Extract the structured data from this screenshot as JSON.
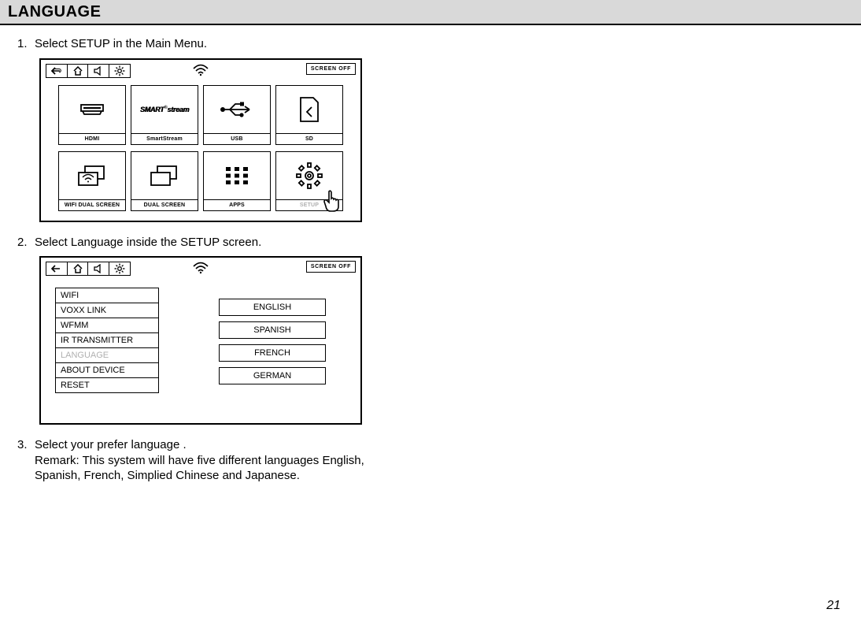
{
  "title": "LANGUAGE",
  "steps": {
    "s1_num": "1.",
    "s1_text": "Select SETUP in the Main Menu.",
    "s2_num": "2.",
    "s2_text": "Select Language inside the SETUP screen.",
    "s3_num": "3.",
    "s3_text": "Select your prefer language .",
    "s3_remark": "Remark: This system will have five different languages English, Spanish, French, Simplied Chinese and Japanese."
  },
  "screen_off": "SCREEN OFF",
  "tiles": {
    "hdmi": "HDMI",
    "smartstream": "SmartStream",
    "smartstream_logo_a": "SMART",
    "smartstream_logo_b": "stream",
    "usb": "USB",
    "sd": "SD",
    "wifi_dual": "WIFI DUAL SCREEN",
    "dual": "DUAL SCREEN",
    "apps": "APPS",
    "setup": "SETUP"
  },
  "setup_sidebar": [
    "WIFI",
    "VOXX LINK",
    "WFMM",
    "IR TRANSMITTER",
    "LANGUAGE",
    "ABOUT DEVICE",
    "RESET"
  ],
  "lang_options": [
    "ENGLISH",
    "SPANISH",
    "FRENCH",
    "GERMAN"
  ],
  "icons": {
    "back": "back-icon",
    "home": "home-icon",
    "volume": "volume-icon",
    "brightness": "brightness-icon",
    "wifi": "wifi-icon"
  },
  "page_number": "21"
}
